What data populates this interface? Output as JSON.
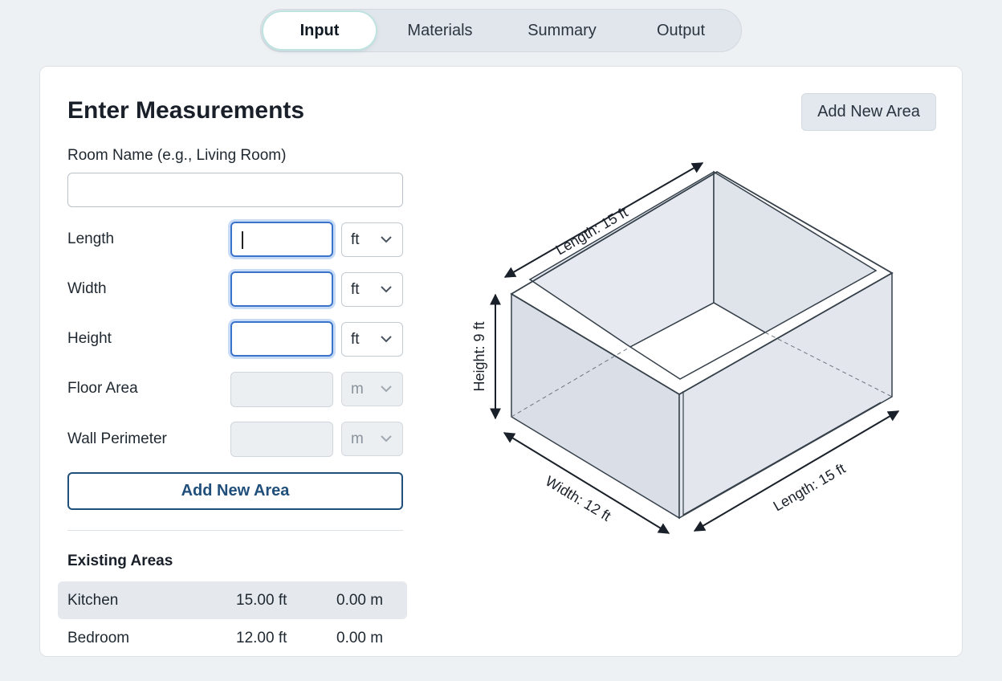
{
  "tabs": [
    {
      "label": "Input"
    },
    {
      "label": "Materials"
    },
    {
      "label": "Summary"
    },
    {
      "label": "Output"
    }
  ],
  "form": {
    "title": "Enter Measurements",
    "add_button_top": "Add New Area",
    "room_label": "Room Name (e.g., Living Room)",
    "room_value": "",
    "fields": [
      {
        "label": "Length",
        "value": "",
        "unit": "ft"
      },
      {
        "label": "Width",
        "value": "",
        "unit": "ft"
      },
      {
        "label": "Height",
        "value": "",
        "unit": "ft"
      },
      {
        "label": "Floor Area",
        "value": "",
        "unit": "m"
      },
      {
        "label": "Wall Perimeter",
        "value": "",
        "unit": "m"
      }
    ],
    "add_button": "Add New Area"
  },
  "existing": {
    "title": "Existing Areas",
    "rows": [
      {
        "name": "Kitchen",
        "dim": "15.00 ft",
        "area": "0.00 m"
      },
      {
        "name": "Bedroom",
        "dim": "12.00 ft",
        "area": "0.00 m"
      }
    ]
  },
  "diagram": {
    "length_top": "Length: 15 ft",
    "height": "Height: 9 ft",
    "width": "Width: 12 ft",
    "length_bottom": "Length: 15 ft"
  },
  "colors": {
    "accent": "#3a73c9",
    "primary_button": "#1f4f7a",
    "active_tab_glow": "#bfe3e0"
  }
}
